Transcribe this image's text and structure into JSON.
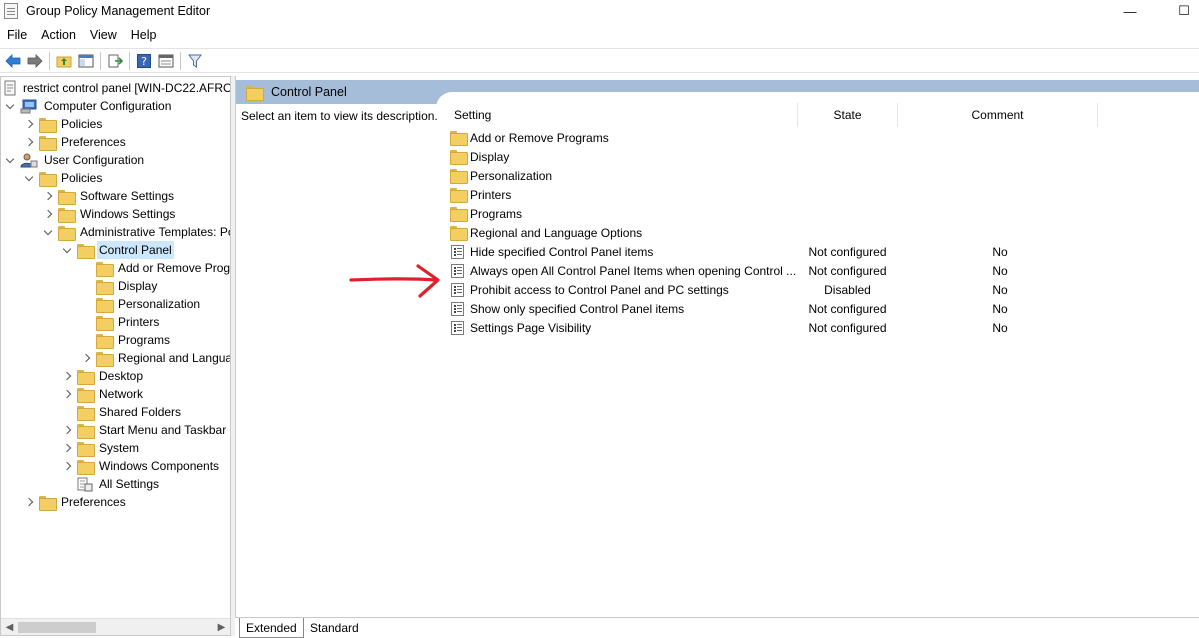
{
  "window": {
    "title": "Group Policy Management Editor",
    "minimize": "—",
    "maximize": "☐"
  },
  "menu": [
    "File",
    "Action",
    "View",
    "Help"
  ],
  "tree": {
    "root": "restrict control panel [WIN-DC22.AFRO",
    "computer_configuration": "Computer Configuration",
    "cc_policies": "Policies",
    "cc_preferences": "Preferences",
    "user_configuration": "User Configuration",
    "uc_policies": "Policies",
    "software_settings": "Software Settings",
    "windows_settings": "Windows Settings",
    "admin_templates": "Administrative Templates: Po",
    "control_panel": "Control Panel",
    "add_remove": "Add or Remove Prog",
    "display": "Display",
    "personalization": "Personalization",
    "printers": "Printers",
    "programs": "Programs",
    "regional": "Regional and Langua",
    "desktop": "Desktop",
    "network": "Network",
    "shared_folders": "Shared Folders",
    "start_menu": "Start Menu and Taskbar",
    "system": "System",
    "windows_components": "Windows Components",
    "all_settings": "All Settings",
    "uc_preferences": "Preferences"
  },
  "right": {
    "header": "Control Panel",
    "description": "Select an item to view its description.",
    "columns": {
      "setting": "Setting",
      "state": "State",
      "comment": "Comment"
    },
    "folders": [
      "Add or Remove Programs",
      "Display",
      "Personalization",
      "Printers",
      "Programs",
      "Regional and Language Options"
    ],
    "policies": [
      {
        "name": "Hide specified Control Panel items",
        "state": "Not configured",
        "comment": "No"
      },
      {
        "name": "Always open All Control Panel Items when opening Control ...",
        "state": "Not configured",
        "comment": "No"
      },
      {
        "name": "Prohibit access to Control Panel and PC settings",
        "state": "Disabled",
        "comment": "No"
      },
      {
        "name": "Show only specified Control Panel items",
        "state": "Not configured",
        "comment": "No"
      },
      {
        "name": "Settings Page Visibility",
        "state": "Not configured",
        "comment": "No"
      }
    ]
  },
  "tabs": {
    "extended": "Extended",
    "standard": "Standard"
  },
  "colors": {
    "header_band": "#a6bdd9",
    "selection": "#cce8ff",
    "annotation_arrow": "#e0202a"
  }
}
